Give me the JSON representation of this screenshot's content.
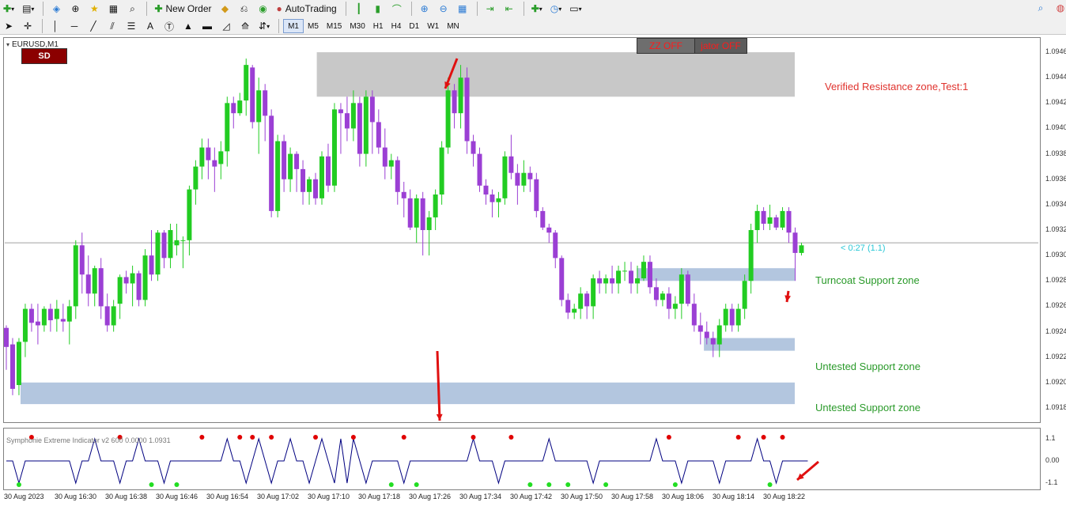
{
  "toolbar": {
    "new_order": "New Order",
    "auto_trading": "AutoTrading",
    "timeframes": [
      "M1",
      "M5",
      "M15",
      "M30",
      "H1",
      "H4",
      "D1",
      "W1",
      "MN"
    ],
    "active_timeframe": "M1"
  },
  "chart": {
    "symbol_label": "EURUSD,M1",
    "sd_button": "SD",
    "zz_off": "ZZ OFF",
    "indicator_off": "jator OFF",
    "countdown": "< 0:27 (1.1)",
    "indicator_label": "Symphonie Extreme Indicator v2 600 0.0000 1.0931",
    "zones": [
      {
        "label": "Verified Resistance zone,Test:1",
        "color": "#e0332e"
      },
      {
        "label": "Turncoat Support zone",
        "color": "#2a9a2a"
      },
      {
        "label": "Untested Support zone",
        "color": "#2a9a2a"
      },
      {
        "label": "Untested Support zone",
        "color": "#2a9a2a"
      }
    ],
    "price_labels": [
      "1.0946",
      "1.0944",
      "1.0942",
      "1.0940",
      "1.0938",
      "1.0936",
      "1.0934",
      "1.0932",
      "1.0930",
      "1.0928",
      "1.0926",
      "1.0924",
      "1.0922",
      "1.0920",
      "1.0918"
    ],
    "indicator_levels": [
      "1.1",
      "0.00",
      "-1.1"
    ],
    "time_labels": [
      "30 Aug 2023",
      "30 Aug 16:30",
      "30 Aug 16:38",
      "30 Aug 16:46",
      "30 Aug 16:54",
      "30 Aug 17:02",
      "30 Aug 17:10",
      "30 Aug 17:18",
      "30 Aug 17:26",
      "30 Aug 17:34",
      "30 Aug 17:42",
      "30 Aug 17:50",
      "30 Aug 17:58",
      "30 Aug 18:06",
      "30 Aug 18:14",
      "30 Aug 18:22"
    ]
  },
  "chart_data": {
    "type": "candlestick",
    "title": "EURUSD,M1",
    "ylim": [
      1.0917,
      1.0947
    ],
    "colors": {
      "bull": "#22cc22",
      "bear": "#9b3fd4",
      "zone_resistance": "#c8c8c8",
      "zone_support": "#b3c6df"
    },
    "candles": [
      {
        "o": 1.09243,
        "h": 1.09245,
        "l": 1.0921,
        "c": 1.09228
      },
      {
        "o": 1.0923,
        "h": 1.09235,
        "l": 1.0919,
        "c": 1.09195
      },
      {
        "o": 1.09198,
        "h": 1.09235,
        "l": 1.0919,
        "c": 1.09232
      },
      {
        "o": 1.09232,
        "h": 1.09262,
        "l": 1.0922,
        "c": 1.09258
      },
      {
        "o": 1.09258,
        "h": 1.09262,
        "l": 1.0924,
        "c": 1.09247
      },
      {
        "o": 1.09248,
        "h": 1.09262,
        "l": 1.0923,
        "c": 1.09245
      },
      {
        "o": 1.09245,
        "h": 1.0926,
        "l": 1.0924,
        "c": 1.09258
      },
      {
        "o": 1.09258,
        "h": 1.09262,
        "l": 1.0924,
        "c": 1.09249
      },
      {
        "o": 1.0925,
        "h": 1.09265,
        "l": 1.0924,
        "c": 1.09258
      },
      {
        "o": 1.0925,
        "h": 1.09262,
        "l": 1.0924,
        "c": 1.09248
      },
      {
        "o": 1.09248,
        "h": 1.09265,
        "l": 1.0923,
        "c": 1.0926
      },
      {
        "o": 1.0926,
        "h": 1.09312,
        "l": 1.0925,
        "c": 1.09308
      },
      {
        "o": 1.09308,
        "h": 1.09318,
        "l": 1.0927,
        "c": 1.09285
      },
      {
        "o": 1.09285,
        "h": 1.093,
        "l": 1.0926,
        "c": 1.0927
      },
      {
        "o": 1.0927,
        "h": 1.09292,
        "l": 1.0926,
        "c": 1.0929
      },
      {
        "o": 1.0929,
        "h": 1.09298,
        "l": 1.0925,
        "c": 1.0926
      },
      {
        "o": 1.0926,
        "h": 1.0927,
        "l": 1.0924,
        "c": 1.09245
      },
      {
        "o": 1.09245,
        "h": 1.09265,
        "l": 1.0924,
        "c": 1.0926
      },
      {
        "o": 1.09262,
        "h": 1.09285,
        "l": 1.0925,
        "c": 1.09283
      },
      {
        "o": 1.09283,
        "h": 1.09288,
        "l": 1.0927,
        "c": 1.09278
      },
      {
        "o": 1.09278,
        "h": 1.09292,
        "l": 1.0926,
        "c": 1.09286
      },
      {
        "o": 1.09286,
        "h": 1.09288,
        "l": 1.0926,
        "c": 1.09265
      },
      {
        "o": 1.09265,
        "h": 1.09305,
        "l": 1.0926,
        "c": 1.093
      },
      {
        "o": 1.093,
        "h": 1.0932,
        "l": 1.0928,
        "c": 1.09285
      },
      {
        "o": 1.09285,
        "h": 1.0932,
        "l": 1.0928,
        "c": 1.09318
      },
      {
        "o": 1.09318,
        "h": 1.0932,
        "l": 1.0929,
        "c": 1.09298
      },
      {
        "o": 1.09298,
        "h": 1.09325,
        "l": 1.0929,
        "c": 1.0932
      },
      {
        "o": 1.09308,
        "h": 1.09325,
        "l": 1.093,
        "c": 1.09312
      },
      {
        "o": 1.09312,
        "h": 1.09315,
        "l": 1.0929,
        "c": 1.09312
      },
      {
        "o": 1.09312,
        "h": 1.09355,
        "l": 1.093,
        "c": 1.09352
      },
      {
        "o": 1.09352,
        "h": 1.09375,
        "l": 1.0934,
        "c": 1.0937
      },
      {
        "o": 1.0937,
        "h": 1.09392,
        "l": 1.0936,
        "c": 1.09385
      },
      {
        "o": 1.09385,
        "h": 1.09392,
        "l": 1.0936,
        "c": 1.09375
      },
      {
        "o": 1.09375,
        "h": 1.09385,
        "l": 1.0935,
        "c": 1.0937
      },
      {
        "o": 1.09372,
        "h": 1.0939,
        "l": 1.0936,
        "c": 1.09382
      },
      {
        "o": 1.09382,
        "h": 1.09425,
        "l": 1.0937,
        "c": 1.0942
      },
      {
        "o": 1.0942,
        "h": 1.09425,
        "l": 1.094,
        "c": 1.09412
      },
      {
        "o": 1.09412,
        "h": 1.09428,
        "l": 1.0941,
        "c": 1.09422
      },
      {
        "o": 1.09422,
        "h": 1.09455,
        "l": 1.0941,
        "c": 1.0945
      },
      {
        "o": 1.09448,
        "h": 1.0945,
        "l": 1.094,
        "c": 1.09405
      },
      {
        "o": 1.09405,
        "h": 1.0944,
        "l": 1.0938,
        "c": 1.0943
      },
      {
        "o": 1.0943,
        "h": 1.09435,
        "l": 1.0939,
        "c": 1.0941
      },
      {
        "o": 1.0941,
        "h": 1.09415,
        "l": 1.0933,
        "c": 1.09335
      },
      {
        "o": 1.09335,
        "h": 1.09395,
        "l": 1.0933,
        "c": 1.0939
      },
      {
        "o": 1.0939,
        "h": 1.09395,
        "l": 1.0935,
        "c": 1.0936
      },
      {
        "o": 1.0936,
        "h": 1.09385,
        "l": 1.0935,
        "c": 1.0938
      },
      {
        "o": 1.0938,
        "h": 1.09382,
        "l": 1.0935,
        "c": 1.09368
      },
      {
        "o": 1.09368,
        "h": 1.09375,
        "l": 1.0934,
        "c": 1.0935
      },
      {
        "o": 1.0935,
        "h": 1.09362,
        "l": 1.0934,
        "c": 1.0936
      },
      {
        "o": 1.0936,
        "h": 1.09365,
        "l": 1.0934,
        "c": 1.09345
      },
      {
        "o": 1.09345,
        "h": 1.09382,
        "l": 1.0934,
        "c": 1.09378
      },
      {
        "o": 1.09378,
        "h": 1.09388,
        "l": 1.0935,
        "c": 1.09355
      },
      {
        "o": 1.09355,
        "h": 1.0942,
        "l": 1.0935,
        "c": 1.09415
      },
      {
        "o": 1.09415,
        "h": 1.0942,
        "l": 1.0938,
        "c": 1.09412
      },
      {
        "o": 1.09412,
        "h": 1.09425,
        "l": 1.0939,
        "c": 1.094
      },
      {
        "o": 1.094,
        "h": 1.0943,
        "l": 1.0939,
        "c": 1.0942
      },
      {
        "o": 1.0942,
        "h": 1.09425,
        "l": 1.0937,
        "c": 1.0938
      },
      {
        "o": 1.0938,
        "h": 1.0943,
        "l": 1.0937,
        "c": 1.09425
      },
      {
        "o": 1.09425,
        "h": 1.0943,
        "l": 1.0938,
        "c": 1.09405
      },
      {
        "o": 1.09405,
        "h": 1.09415,
        "l": 1.0938,
        "c": 1.09385
      },
      {
        "o": 1.09385,
        "h": 1.094,
        "l": 1.0936,
        "c": 1.0937
      },
      {
        "o": 1.0937,
        "h": 1.0938,
        "l": 1.0936,
        "c": 1.09375
      },
      {
        "o": 1.09375,
        "h": 1.09378,
        "l": 1.0934,
        "c": 1.0935
      },
      {
        "o": 1.0935,
        "h": 1.09358,
        "l": 1.0933,
        "c": 1.09345
      },
      {
        "o": 1.09345,
        "h": 1.09352,
        "l": 1.0932,
        "c": 1.09322
      },
      {
        "o": 1.09322,
        "h": 1.09348,
        "l": 1.0931,
        "c": 1.09345
      },
      {
        "o": 1.09345,
        "h": 1.0935,
        "l": 1.093,
        "c": 1.0932
      },
      {
        "o": 1.0932,
        "h": 1.09335,
        "l": 1.093,
        "c": 1.0933
      },
      {
        "o": 1.0933,
        "h": 1.09352,
        "l": 1.0932,
        "c": 1.09348
      },
      {
        "o": 1.09348,
        "h": 1.0939,
        "l": 1.0934,
        "c": 1.09385
      },
      {
        "o": 1.09385,
        "h": 1.0944,
        "l": 1.0938,
        "c": 1.0943
      },
      {
        "o": 1.0943,
        "h": 1.09435,
        "l": 1.094,
        "c": 1.09412
      },
      {
        "o": 1.09412,
        "h": 1.0945,
        "l": 1.094,
        "c": 1.0944
      },
      {
        "o": 1.0944,
        "h": 1.09448,
        "l": 1.0938,
        "c": 1.0939
      },
      {
        "o": 1.0939,
        "h": 1.09395,
        "l": 1.0937,
        "c": 1.0938
      },
      {
        "o": 1.0938,
        "h": 1.09385,
        "l": 1.0935,
        "c": 1.09355
      },
      {
        "o": 1.09355,
        "h": 1.0936,
        "l": 1.0934,
        "c": 1.09348
      },
      {
        "o": 1.09348,
        "h": 1.09352,
        "l": 1.0933,
        "c": 1.09342
      },
      {
        "o": 1.09342,
        "h": 1.0935,
        "l": 1.0933,
        "c": 1.09345
      },
      {
        "o": 1.09345,
        "h": 1.09382,
        "l": 1.0934,
        "c": 1.09378
      },
      {
        "o": 1.09378,
        "h": 1.09395,
        "l": 1.0936,
        "c": 1.09365
      },
      {
        "o": 1.09365,
        "h": 1.09372,
        "l": 1.0934,
        "c": 1.09355
      },
      {
        "o": 1.09355,
        "h": 1.09375,
        "l": 1.0935,
        "c": 1.09365
      },
      {
        "o": 1.09365,
        "h": 1.0937,
        "l": 1.0935,
        "c": 1.0936
      },
      {
        "o": 1.0936,
        "h": 1.09365,
        "l": 1.0933,
        "c": 1.09335
      },
      {
        "o": 1.09335,
        "h": 1.09338,
        "l": 1.0932,
        "c": 1.09322
      },
      {
        "o": 1.09322,
        "h": 1.09325,
        "l": 1.0931,
        "c": 1.09318
      },
      {
        "o": 1.09318,
        "h": 1.0932,
        "l": 1.0929,
        "c": 1.09298
      },
      {
        "o": 1.09298,
        "h": 1.093,
        "l": 1.0926,
        "c": 1.09265
      },
      {
        "o": 1.09265,
        "h": 1.0927,
        "l": 1.0925,
        "c": 1.09255
      },
      {
        "o": 1.09255,
        "h": 1.09262,
        "l": 1.0925,
        "c": 1.09258
      },
      {
        "o": 1.09258,
        "h": 1.09275,
        "l": 1.0925,
        "c": 1.0927
      },
      {
        "o": 1.0927,
        "h": 1.09272,
        "l": 1.0925,
        "c": 1.0926
      },
      {
        "o": 1.0926,
        "h": 1.09285,
        "l": 1.0925,
        "c": 1.09282
      },
      {
        "o": 1.09282,
        "h": 1.09288,
        "l": 1.0927,
        "c": 1.09278
      },
      {
        "o": 1.09278,
        "h": 1.09285,
        "l": 1.0927,
        "c": 1.09282
      },
      {
        "o": 1.09282,
        "h": 1.09292,
        "l": 1.0927,
        "c": 1.09278
      },
      {
        "o": 1.09278,
        "h": 1.09292,
        "l": 1.0927,
        "c": 1.09288
      },
      {
        "o": 1.09288,
        "h": 1.09295,
        "l": 1.0928,
        "c": 1.09288
      },
      {
        "o": 1.09288,
        "h": 1.09295,
        "l": 1.0927,
        "c": 1.09278
      },
      {
        "o": 1.09278,
        "h": 1.09292,
        "l": 1.0927,
        "c": 1.09282
      },
      {
        "o": 1.09282,
        "h": 1.093,
        "l": 1.0928,
        "c": 1.09295
      },
      {
        "o": 1.09295,
        "h": 1.093,
        "l": 1.0927,
        "c": 1.09275
      },
      {
        "o": 1.09275,
        "h": 1.09282,
        "l": 1.0926,
        "c": 1.09265
      },
      {
        "o": 1.09265,
        "h": 1.09272,
        "l": 1.0926,
        "c": 1.0927
      },
      {
        "o": 1.0927,
        "h": 1.09275,
        "l": 1.0925,
        "c": 1.09258
      },
      {
        "o": 1.09258,
        "h": 1.09268,
        "l": 1.0925,
        "c": 1.09262
      },
      {
        "o": 1.09262,
        "h": 1.0929,
        "l": 1.0925,
        "c": 1.09285
      },
      {
        "o": 1.09285,
        "h": 1.09288,
        "l": 1.0926,
        "c": 1.09262
      },
      {
        "o": 1.09262,
        "h": 1.0927,
        "l": 1.0924,
        "c": 1.09245
      },
      {
        "o": 1.09245,
        "h": 1.09255,
        "l": 1.0923,
        "c": 1.0924
      },
      {
        "o": 1.0924,
        "h": 1.09248,
        "l": 1.0923,
        "c": 1.09235
      },
      {
        "o": 1.09235,
        "h": 1.0924,
        "l": 1.0922,
        "c": 1.0923
      },
      {
        "o": 1.0923,
        "h": 1.0925,
        "l": 1.0922,
        "c": 1.09245
      },
      {
        "o": 1.09245,
        "h": 1.09262,
        "l": 1.0924,
        "c": 1.09258
      },
      {
        "o": 1.09258,
        "h": 1.09262,
        "l": 1.0924,
        "c": 1.09245
      },
      {
        "o": 1.09245,
        "h": 1.09262,
        "l": 1.0924,
        "c": 1.09258
      },
      {
        "o": 1.09258,
        "h": 1.09285,
        "l": 1.0925,
        "c": 1.0928
      },
      {
        "o": 1.0928,
        "h": 1.09325,
        "l": 1.0927,
        "c": 1.0932
      },
      {
        "o": 1.0932,
        "h": 1.0934,
        "l": 1.0931,
        "c": 1.09335
      },
      {
        "o": 1.09335,
        "h": 1.09338,
        "l": 1.0932,
        "c": 1.09325
      },
      {
        "o": 1.09325,
        "h": 1.0934,
        "l": 1.0932,
        "c": 1.0933
      },
      {
        "o": 1.0933,
        "h": 1.09332,
        "l": 1.0932,
        "c": 1.09322
      },
      {
        "o": 1.09322,
        "h": 1.09338,
        "l": 1.0932,
        "c": 1.09335
      },
      {
        "o": 1.09335,
        "h": 1.09338,
        "l": 1.0931,
        "c": 1.09318
      },
      {
        "o": 1.09318,
        "h": 1.09322,
        "l": 1.0928,
        "c": 1.09302
      },
      {
        "o": 1.09302,
        "h": 1.0931,
        "l": 1.093,
        "c": 1.09308
      }
    ],
    "zones": [
      {
        "type": "resistance",
        "top": 1.0946,
        "bottom": 1.09425,
        "first_candle": 0.395,
        "end": 1.0
      },
      {
        "type": "support",
        "top": 1.0929,
        "bottom": 1.0928,
        "first_candle": 0.8,
        "end": 1.0
      },
      {
        "type": "support",
        "top": 1.09235,
        "bottom": 1.09225,
        "first_candle": 0.885,
        "end": 1.0
      },
      {
        "type": "support",
        "top": 1.092,
        "bottom": 1.09183,
        "first_candle": 0.02,
        "end": 1.0
      }
    ],
    "current_price": 1.0931,
    "indicator": {
      "levels": [
        1.1,
        0.0,
        -1.1
      ],
      "line": [
        0,
        0,
        -1.1,
        0,
        0,
        0,
        0,
        0,
        0,
        0,
        0,
        -1.1,
        0,
        0,
        1.1,
        0,
        0,
        0,
        -1.1,
        0,
        0,
        1.1,
        0,
        0,
        0,
        -1.1,
        0,
        0,
        0,
        0,
        0,
        0,
        0,
        0,
        0,
        1.1,
        0,
        0,
        -1.1,
        0,
        1.1,
        0,
        -1.1,
        0,
        0,
        1.1,
        0,
        0,
        -1.1,
        0,
        1.1,
        0,
        -1.1,
        1.1,
        -1.1,
        1.1,
        0,
        -1.1,
        0,
        0,
        0,
        0,
        0,
        -1.1,
        0,
        0,
        0,
        0,
        0,
        0,
        0,
        0,
        0,
        0,
        1.1,
        0,
        0,
        0,
        -1.1,
        0,
        0,
        0,
        0,
        0,
        0,
        0,
        1.1,
        0,
        0,
        0,
        0,
        0,
        0,
        -1.1,
        0,
        0,
        0,
        0,
        0,
        0,
        0,
        0,
        0,
        1.1,
        0,
        0,
        0,
        -1.1,
        0,
        0,
        0,
        0,
        0,
        -1.1,
        0,
        0,
        0,
        0,
        0,
        1.1,
        0,
        0,
        -1.1,
        0,
        0,
        0,
        0,
        0
      ],
      "red_dots": [
        0.03,
        0.145,
        0.245,
        0.295,
        0.315,
        0.335,
        0.39,
        0.44,
        0.5,
        0.59,
        0.64,
        0.84,
        0.985,
        0.93,
        0.96
      ],
      "green_dots": [
        0.015,
        0.18,
        0.215,
        0.49,
        0.52,
        0.66,
        0.69,
        0.71,
        0.76,
        0.85,
        0.97,
        1.07,
        1.15,
        1.3
      ],
      "arrow_note": "red arrows"
    }
  }
}
